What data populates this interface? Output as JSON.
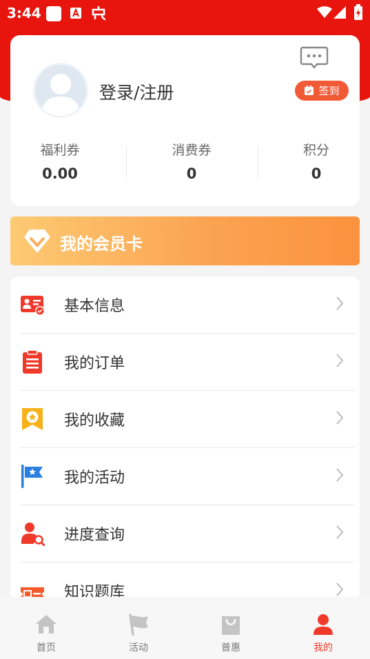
{
  "status_bar": {
    "time": "3:44"
  },
  "profile": {
    "login_label": "登录/注册",
    "signin_label": "签到",
    "stats": [
      {
        "label": "福利券",
        "value": "0.00"
      },
      {
        "label": "消费券",
        "value": "0"
      },
      {
        "label": "积分",
        "value": "0"
      }
    ]
  },
  "member_card": {
    "title": "我的会员卡"
  },
  "menu": {
    "items": [
      {
        "label": "基本信息",
        "icon": "id-card-icon"
      },
      {
        "label": "我的订单",
        "icon": "clipboard-icon"
      },
      {
        "label": "我的收藏",
        "icon": "bookmark-star-icon"
      },
      {
        "label": "我的活动",
        "icon": "flag-icon"
      },
      {
        "label": "进度查询",
        "icon": "user-search-icon"
      },
      {
        "label": "知识题库",
        "icon": "ticket-icon"
      }
    ]
  },
  "tabbar": {
    "tabs": [
      {
        "label": "首页",
        "icon": "home-icon"
      },
      {
        "label": "活动",
        "icon": "flag-icon"
      },
      {
        "label": "普惠",
        "icon": "shopping-bag-icon"
      },
      {
        "label": "我的",
        "icon": "person-icon",
        "active": true
      }
    ]
  },
  "colors": {
    "brand_red": "#e8150e",
    "accent_orange": "#f15a37",
    "active_tab": "#ef3a2b"
  }
}
